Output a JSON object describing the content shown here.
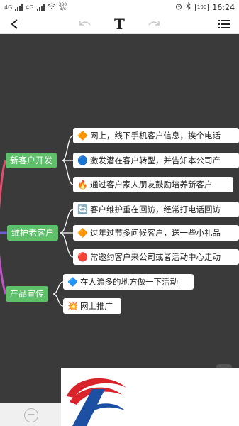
{
  "status": {
    "sig1": "4G",
    "sig2": "4G",
    "net_speed": "380",
    "net_unit": "B/s",
    "battery": "100",
    "time": "16:24"
  },
  "toolbar": {
    "back_icon": "back-arrow-icon",
    "undo_icon": "undo-icon",
    "text_label": "T",
    "redo_icon": "redo-icon",
    "menu_icon": "menu-icon"
  },
  "mindmap": {
    "branches": [
      {
        "label": "新客户开发",
        "color": "#5ec16a",
        "children": [
          {
            "emoji": "🔶",
            "text": "网上，线下手机客户信息，挨个电话"
          },
          {
            "emoji": "🔵",
            "text": "激发潜在客户转型，并告知本公司产"
          },
          {
            "emoji": "🔥",
            "text": "通过客户家人朋友鼓励培养新客户"
          }
        ]
      },
      {
        "label": "维护老客户",
        "color": "#5ec16a",
        "children": [
          {
            "emoji": "🔄",
            "text": "客户维护重在回访，经常打电话回访"
          },
          {
            "emoji": "🔶",
            "text": "过年过节多问候客户，送一些小礼品"
          },
          {
            "emoji": "🔴",
            "text": "常邀约客户来公司或者活动中心走动"
          }
        ]
      },
      {
        "label": "产品宣传",
        "color": "#5ec16a",
        "children": [
          {
            "emoji": "🔷",
            "text": "在人流多的地方做一下活动"
          },
          {
            "emoji": "💥",
            "text": "网上推广"
          }
        ]
      }
    ]
  },
  "zoom": {
    "zoom_out_label": "−"
  }
}
